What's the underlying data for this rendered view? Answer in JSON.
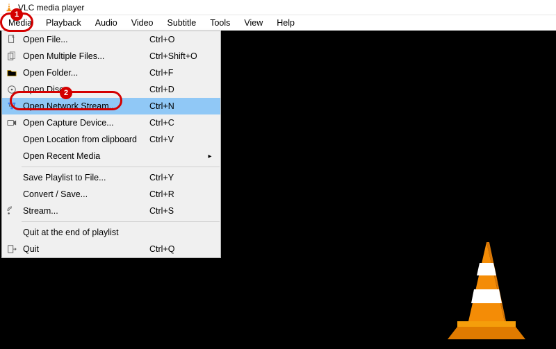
{
  "window": {
    "title": "VLC media player"
  },
  "menubar": {
    "items": [
      {
        "label": "Media"
      },
      {
        "label": "Playback"
      },
      {
        "label": "Audio"
      },
      {
        "label": "Video"
      },
      {
        "label": "Subtitle"
      },
      {
        "label": "Tools"
      },
      {
        "label": "View"
      },
      {
        "label": "Help"
      }
    ]
  },
  "media_menu": {
    "groups": [
      [
        {
          "icon": "file-icon",
          "label": "Open File...",
          "shortcut": "Ctrl+O"
        },
        {
          "icon": "files-icon",
          "label": "Open Multiple Files...",
          "shortcut": "Ctrl+Shift+O"
        },
        {
          "icon": "folder-icon",
          "label": "Open Folder...",
          "shortcut": "Ctrl+F"
        },
        {
          "icon": "disc-icon",
          "label": "Open Disc...",
          "shortcut": "Ctrl+D"
        },
        {
          "icon": "network-icon",
          "label": "Open Network Stream...",
          "shortcut": "Ctrl+N",
          "highlight": true
        },
        {
          "icon": "capture-icon",
          "label": "Open Capture Device...",
          "shortcut": "Ctrl+C"
        },
        {
          "icon": "",
          "label": "Open Location from clipboard",
          "shortcut": "Ctrl+V"
        },
        {
          "icon": "",
          "label": "Open Recent Media",
          "shortcut": "",
          "submenu": true
        }
      ],
      [
        {
          "icon": "",
          "label": "Save Playlist to File...",
          "shortcut": "Ctrl+Y"
        },
        {
          "icon": "",
          "label": "Convert / Save...",
          "shortcut": "Ctrl+R"
        },
        {
          "icon": "stream-icon",
          "label": "Stream...",
          "shortcut": "Ctrl+S"
        }
      ],
      [
        {
          "icon": "",
          "label": "Quit at the end of playlist",
          "shortcut": ""
        },
        {
          "icon": "quit-icon",
          "label": "Quit",
          "shortcut": "Ctrl+Q"
        }
      ]
    ]
  },
  "annotations": {
    "a1": "1",
    "a2": "2"
  }
}
